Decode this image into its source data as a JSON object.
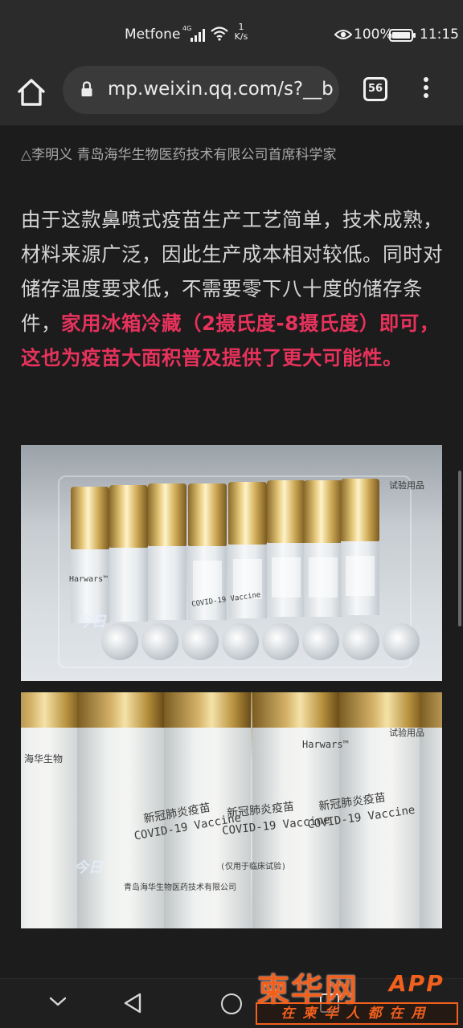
{
  "status_bar": {
    "carrier": "Metfone",
    "network": "4G",
    "net_speed_value": "1",
    "net_speed_unit": "K/s",
    "battery": "100%",
    "time": "11:15"
  },
  "browser": {
    "url": "mp.weixin.qq.com/s?__b",
    "tab_count": "56"
  },
  "article": {
    "caption": "△李明义  青岛海华生物医药技术有限公司首席科学家",
    "paragraph_normal": "由于这款鼻喷式疫苗生产工艺简单，技术成熟，材料来源广泛，因此生产成本相对较低。同时对储存温度要求低，不需要零下八十度的储存条件，",
    "paragraph_highlight": "家用冰箱冷藏（2摄氏度-8摄氏度）即可，这也为疫苗大面积普及提供了更大可能性。",
    "photo1_tag": "试验用品",
    "photo2_tag": "试验用品",
    "vial_label_cn": "新冠肺炎疫苗",
    "vial_label_en": "COVID-19 Vaccine",
    "vial_label_note": "(仅用于临床试验)",
    "vial_brand": "Harwars™",
    "vial_brand_cn": "海华生物",
    "vial_maker": "青岛海华生物医药技术有限公司",
    "watermark": "今日"
  },
  "overlay_logo": {
    "main": "柬华网",
    "app": "APP",
    "slogan": "在柬华人都在用"
  },
  "colors": {
    "highlight": "#e8325c",
    "logo": "#f2601e"
  }
}
